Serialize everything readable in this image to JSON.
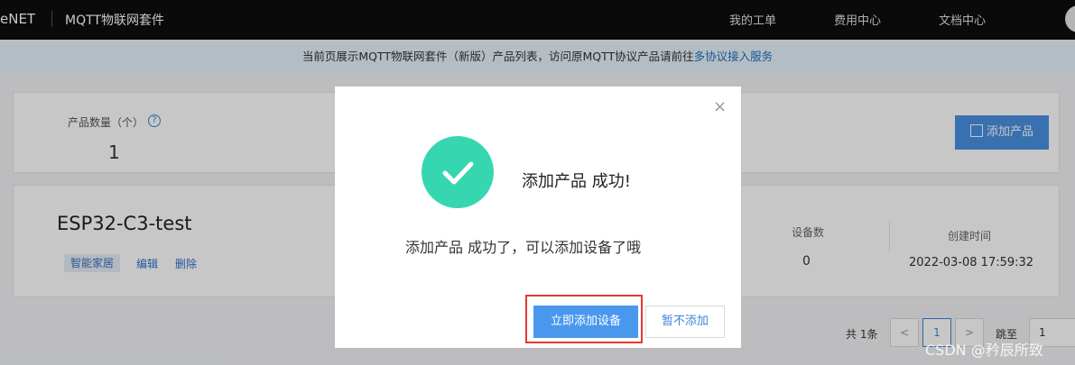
{
  "topbar": {
    "brand": "eNET",
    "product": "MQTT物联网套件",
    "nav": [
      "我的工单",
      "费用中心",
      "文档中心"
    ]
  },
  "notice": {
    "text": "当前页展示MQTT物联网套件（新版）产品列表，访问原MQTT协议产品请前往",
    "link": "多协议接入服务"
  },
  "summary": {
    "label": "产品数量（个）",
    "help_icon": "?",
    "value": "1",
    "add_button": "添加产品"
  },
  "product": {
    "name": "ESP32-C3-test",
    "tag": "智能家居",
    "edit": "编辑",
    "delete": "删除",
    "device_count_label": "设备数",
    "device_count": "0",
    "created_label": "创建时间",
    "created_time": "2022-03-08 17:59:32"
  },
  "pagination": {
    "total": "共 1条",
    "prev": "<",
    "current": "1",
    "next": ">",
    "jump_label": "跳至",
    "jump_value": "1"
  },
  "modal": {
    "close": "×",
    "title": "添加产品 成功!",
    "message": "添加产品 成功了，可以添加设备了哦",
    "primary": "立即添加设备",
    "secondary": "暂不添加",
    "success_color": "#36d7b0"
  },
  "watermark": "CSDN @矜辰所致"
}
